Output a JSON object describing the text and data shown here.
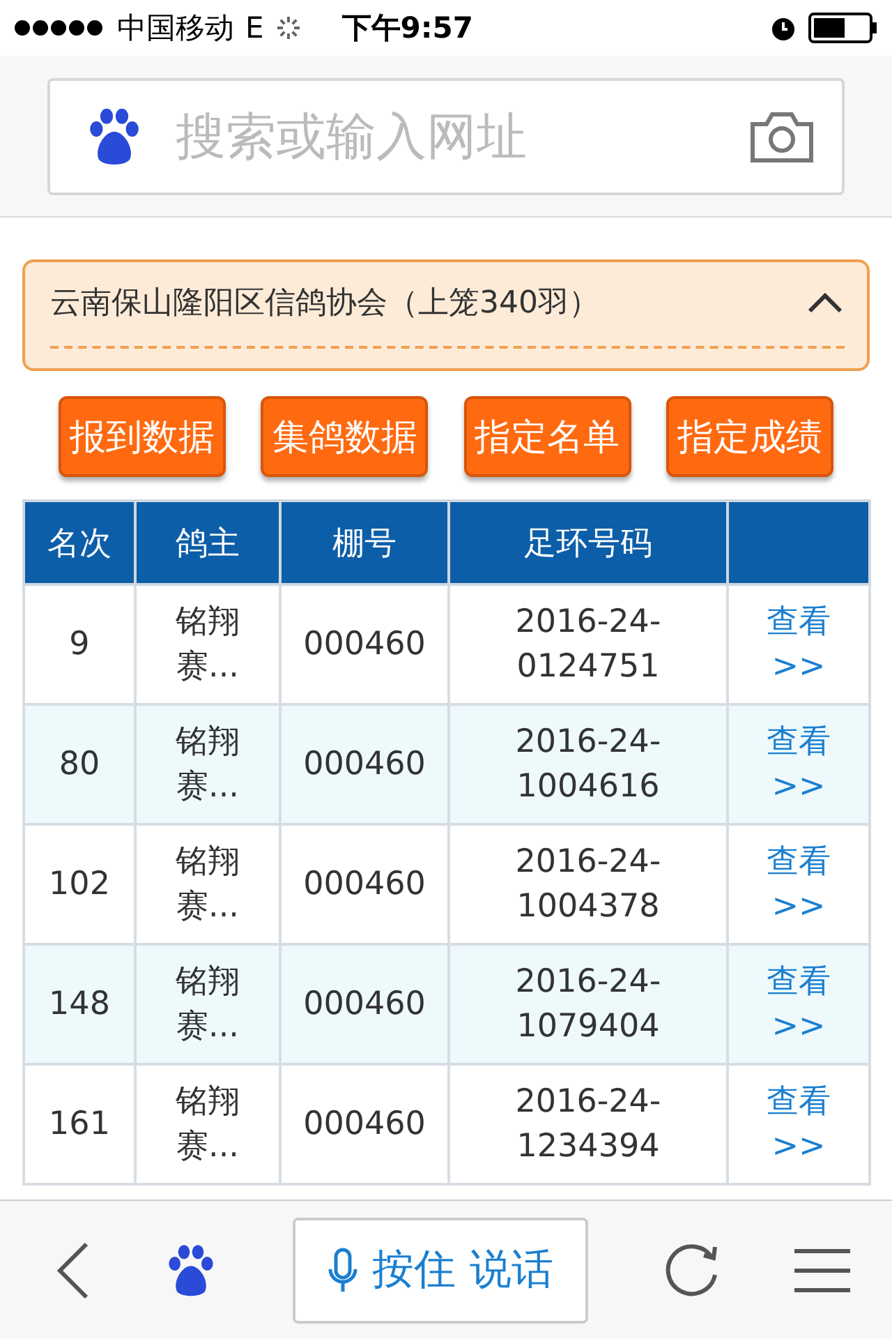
{
  "status_bar": {
    "carrier": "中国移动",
    "network": "E",
    "time": "下午9:57"
  },
  "search": {
    "placeholder": "搜索或输入网址"
  },
  "panel": {
    "title": "云南保山隆阳区信鸽协会（上笼340羽）",
    "expanded": true
  },
  "buttons": [
    "报到数据",
    "集鸽数据",
    "指定名单",
    "指定成绩"
  ],
  "table": {
    "columns": [
      "名次",
      "鸽主",
      "棚号",
      "足环号码"
    ],
    "rows": [
      {
        "rank": "9",
        "owner": "铭翔赛...",
        "loft": "000460",
        "ring": "2016-24-0124751",
        "link": "查看>>"
      },
      {
        "rank": "80",
        "owner": "铭翔赛...",
        "loft": "000460",
        "ring": "2016-24-1004616",
        "link": "查看>>"
      },
      {
        "rank": "102",
        "owner": "铭翔赛...",
        "loft": "000460",
        "ring": "2016-24-1004378",
        "link": "查看>>"
      },
      {
        "rank": "148",
        "owner": "铭翔赛...",
        "loft": "000460",
        "ring": "2016-24-1079404",
        "link": "查看>>"
      },
      {
        "rank": "161",
        "owner": "铭翔赛...",
        "loft": "000460",
        "ring": "2016-24-1234394",
        "link": "查看>>"
      }
    ]
  },
  "toolbar": {
    "voice_button": "按住 说话"
  }
}
